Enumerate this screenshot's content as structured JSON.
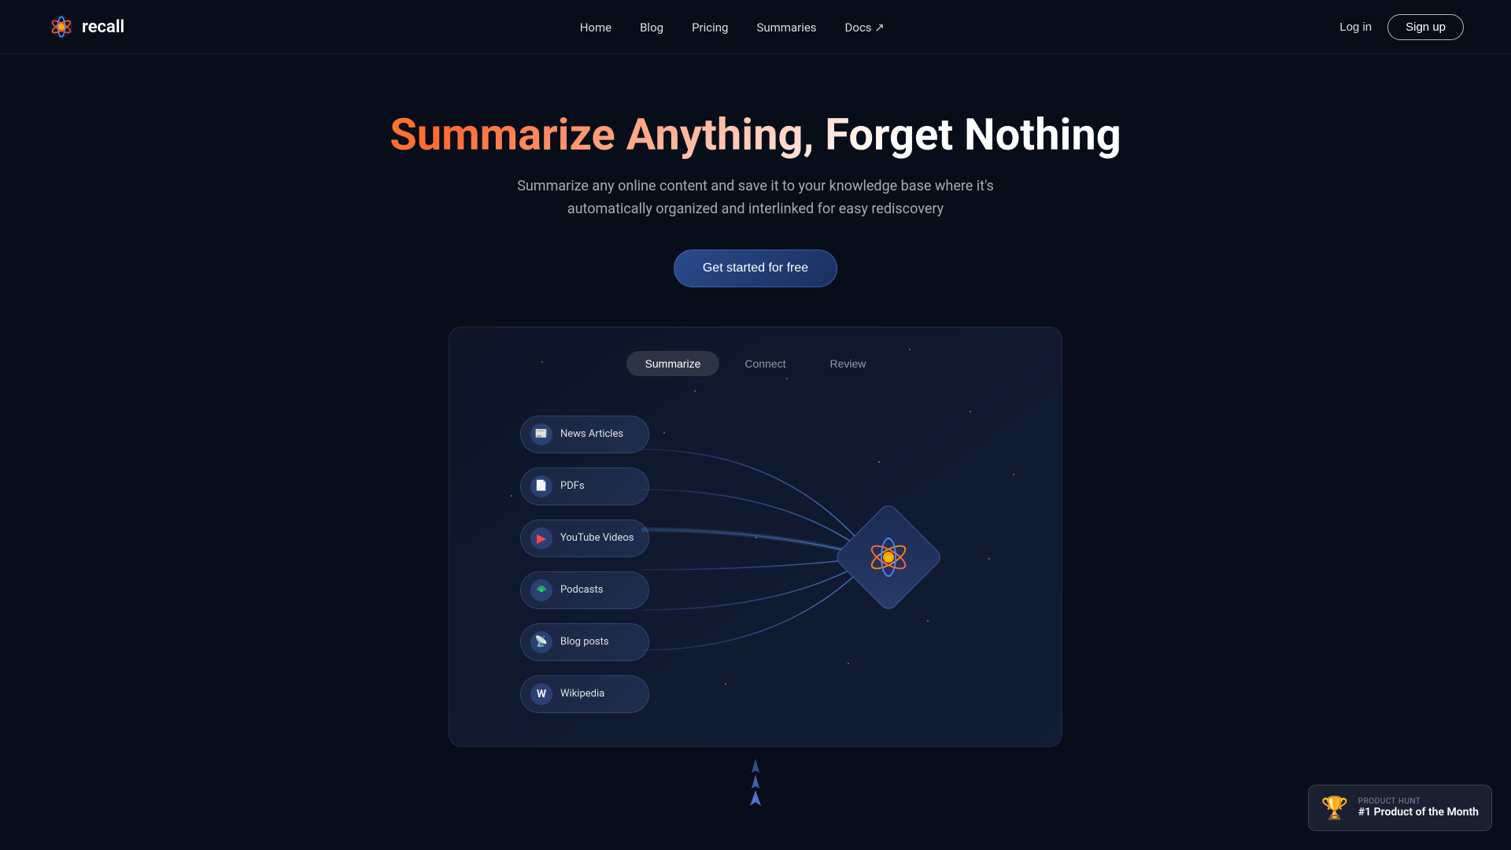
{
  "nav": {
    "logo_text": "recall",
    "links": [
      {
        "label": "Home",
        "id": "home"
      },
      {
        "label": "Blog",
        "id": "blog"
      },
      {
        "label": "Pricing",
        "id": "pricing"
      },
      {
        "label": "Summaries",
        "id": "summaries"
      },
      {
        "label": "Docs ↗",
        "id": "docs"
      }
    ],
    "login_label": "Log in",
    "signup_label": "Sign up"
  },
  "hero": {
    "title": "Summarize Anything, Forget Nothing",
    "subtitle": "Summarize any online content and save it to your knowledge base where it's automatically organized and interlinked for easy rediscovery",
    "cta_label": "Get started for free"
  },
  "demo": {
    "tabs": [
      {
        "label": "Summarize",
        "active": true
      },
      {
        "label": "Connect",
        "active": false
      },
      {
        "label": "Review",
        "active": false
      }
    ],
    "sources": [
      {
        "label": "News Articles",
        "icon": "📰",
        "id": "news-articles"
      },
      {
        "label": "PDFs",
        "icon": "📄",
        "id": "pdfs"
      },
      {
        "label": "YouTube Videos",
        "icon": "▶",
        "id": "youtube-videos"
      },
      {
        "label": "Podcasts",
        "icon": "🎵",
        "id": "podcasts"
      },
      {
        "label": "Blog posts",
        "icon": "📡",
        "id": "blog-posts"
      },
      {
        "label": "Wikipedia",
        "icon": "W",
        "id": "wikipedia"
      }
    ],
    "center_label": "recall"
  },
  "product_hunt": {
    "label": "PRODUCT HUNT",
    "title": "#1 Product of the Month",
    "trophy": "🏆"
  }
}
